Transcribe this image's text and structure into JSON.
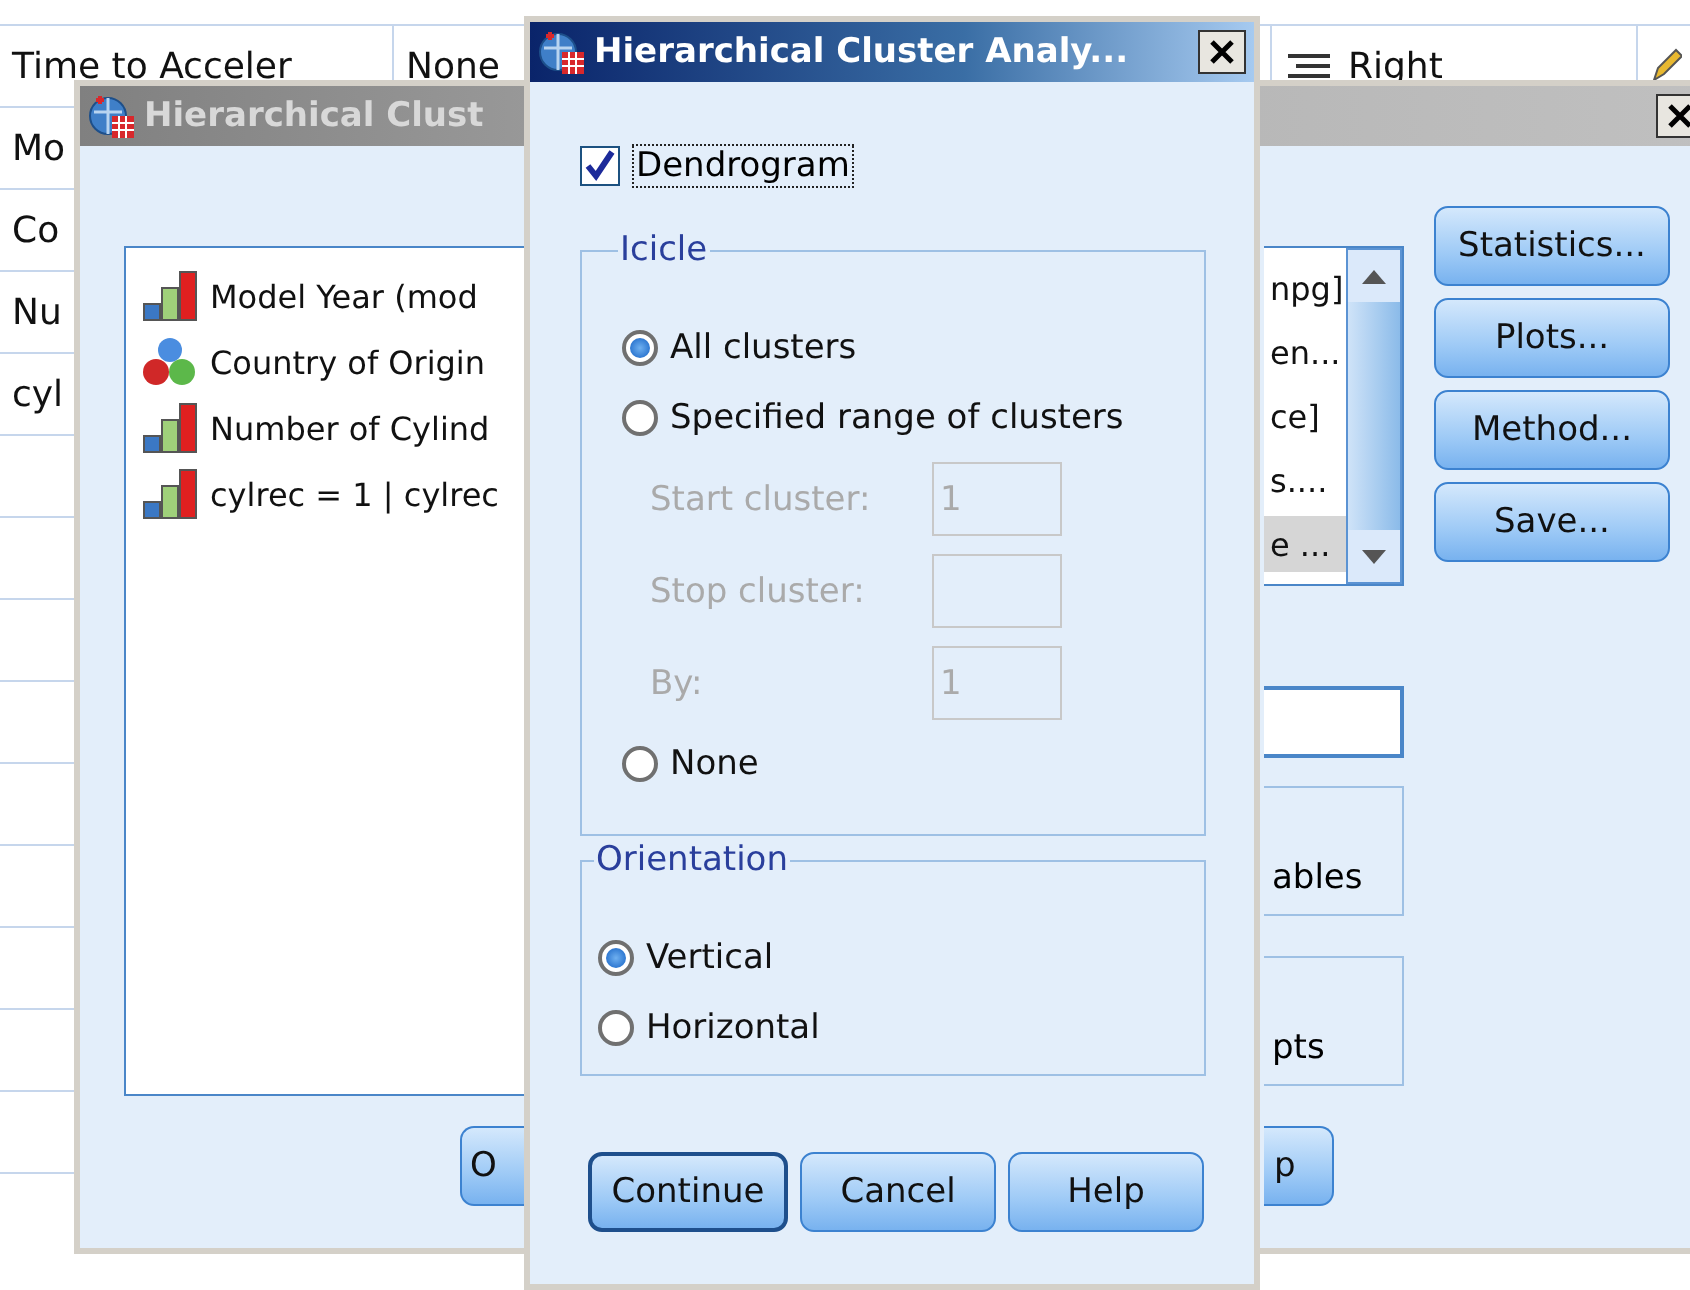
{
  "spreadsheet": {
    "rows": [
      {
        "column_1": "Time to Acceler",
        "column_2": "None",
        "column_5": "Right"
      },
      {
        "column_1": "Mo"
      },
      {
        "column_1": "Co"
      },
      {
        "column_1": "Nu"
      },
      {
        "column_1": "cyl"
      }
    ]
  },
  "back_window": {
    "title": "Hierarchical Clust",
    "source_variables": [
      {
        "label": "Model Year (mod",
        "kind": "scale"
      },
      {
        "label": "Country of Origin",
        "kind": "nominal"
      },
      {
        "label": "Number of Cylind",
        "kind": "scale"
      },
      {
        "label": "cylrec = 1 | cylrec",
        "kind": "scale"
      }
    ],
    "target_list": [
      {
        "label": "npg]",
        "selected": false
      },
      {
        "label": "en...",
        "selected": false
      },
      {
        "label": "ce]",
        "selected": false
      },
      {
        "label": "s....",
        "selected": false
      },
      {
        "label": "e ...",
        "selected": true
      }
    ],
    "side_buttons": [
      "Statistics...",
      "Plots...",
      "Method...",
      "Save..."
    ],
    "group_labels": [
      "ables",
      "pts"
    ],
    "bottom_buttons": [
      "O",
      "p"
    ]
  },
  "dialog": {
    "title": "Hierarchical Cluster Analy...",
    "dendrogram": {
      "label": "Dendrogram",
      "checked": true
    },
    "icicle": {
      "title": "Icicle",
      "items": [
        {
          "kind": "radio",
          "label": "All clusters",
          "selected": true
        },
        {
          "kind": "radio",
          "label": "Specified range of clusters",
          "selected": false
        },
        {
          "kind": "field",
          "label": "Start cluster:",
          "value": "1",
          "disabled": true
        },
        {
          "kind": "field",
          "label": "Stop cluster:",
          "disabled": true
        },
        {
          "kind": "field",
          "label": "By:",
          "value": "1",
          "disabled": true
        },
        {
          "kind": "radio",
          "label": "None",
          "selected": false
        }
      ]
    },
    "orientation": {
      "title": "Orientation",
      "options": [
        {
          "label": "Vertical",
          "selected": true
        },
        {
          "label": "Horizontal",
          "selected": false
        }
      ]
    },
    "buttons": [
      {
        "label": "Continue",
        "default": true
      },
      {
        "label": "Cancel",
        "default": false
      },
      {
        "label": "Help",
        "default": false
      }
    ]
  }
}
